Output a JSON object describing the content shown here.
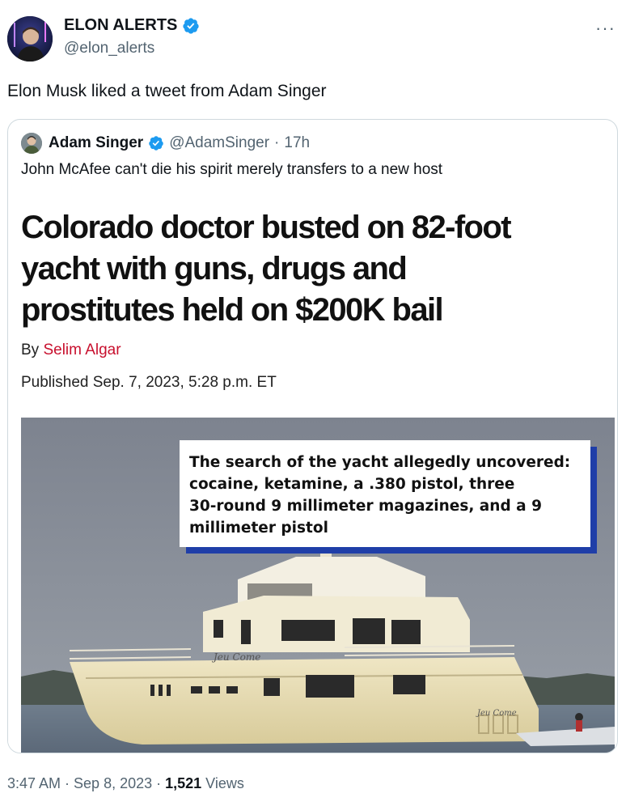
{
  "tweet": {
    "author": {
      "display_name": "ELON ALERTS",
      "handle": "@elon_alerts",
      "verified": true,
      "avatar_icon": "profile-photo-icon"
    },
    "more_label": "···",
    "text": "Elon Musk liked a tweet from Adam Singer",
    "timestamp": "3:47 AM · Sep 8, 2023 · ",
    "views_count": "1,521",
    "views_label": " Views"
  },
  "quoted_tweet": {
    "author": {
      "display_name": "Adam Singer",
      "handle": "@AdamSinger",
      "verified": true
    },
    "separator": " · ",
    "time_ago": "17h",
    "text": "John McAfee can't die his spirit merely transfers to a new host"
  },
  "article": {
    "headline_lines": [
      "Colorado doctor busted on 82-foot",
      "yacht with guns, drugs and",
      "prostitutes held on $200K bail"
    ],
    "by_label": "By ",
    "author": "Selim Algar",
    "published": "Published Sep. 7, 2023, 5:28 p.m. ET",
    "callout_lines": [
      "The search of the yacht allegedly uncovered:",
      "cocaine, ketamine, a .380 pistol, three",
      "30-round 9 millimeter magazines, and a 9",
      "millimeter pistol"
    ],
    "yacht_names": [
      "Jeu Come",
      "Jeu Come"
    ]
  },
  "colors": {
    "verified_blue": "#1d9bf0",
    "text_primary": "#0f1419",
    "text_secondary": "#536471",
    "author_red": "#c8102e",
    "callout_shadow": "#1f3ea8"
  }
}
